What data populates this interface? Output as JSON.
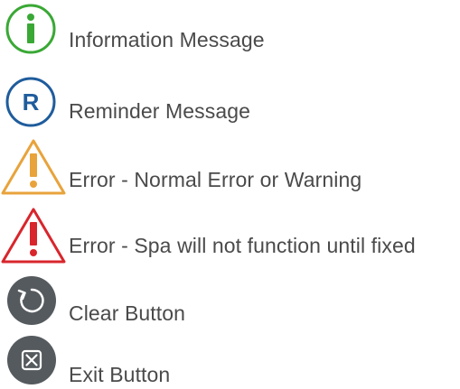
{
  "legend": {
    "items": [
      {
        "icon": "info-circle-icon",
        "label": "Information Message",
        "color": "#3aa835"
      },
      {
        "icon": "reminder-circle-icon",
        "glyph": "R",
        "label": "Reminder Message",
        "color": "#1f5c9c"
      },
      {
        "icon": "warning-triangle-icon",
        "label": "Error - Normal Error or Warning",
        "color": "#e8a33b"
      },
      {
        "icon": "critical-triangle-icon",
        "label": "Error - Spa will not function until fixed",
        "color": "#d8262c"
      },
      {
        "icon": "clear-refresh-icon",
        "label": "Clear Button",
        "color": "#555a5e"
      },
      {
        "icon": "exit-x-box-icon",
        "label": "Exit Button",
        "color": "#555a5e"
      }
    ]
  }
}
